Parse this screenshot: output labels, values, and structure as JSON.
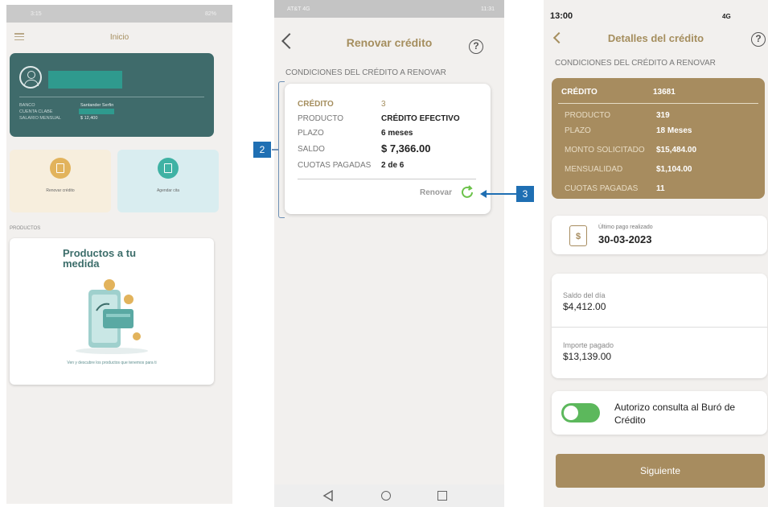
{
  "colors": {
    "gold": "#a58e5e",
    "teal": "#3f6b6b",
    "annotation_blue": "#1f6fb3",
    "toggle_green": "#5cb85c"
  },
  "screen1": {
    "status_time": "3:15",
    "status_right": "82%",
    "title": "Inicio",
    "account": {
      "rows": [
        {
          "label": "BANCO",
          "value": "Santander Serfin"
        },
        {
          "label": "CUENTA CLABE",
          "value": ""
        },
        {
          "label": "SALARIO MENSUAL",
          "value": "$ 12,400"
        }
      ]
    },
    "tiles": [
      {
        "label": "Renovar crédito",
        "icon": "document-icon"
      },
      {
        "label": "Agendar cita",
        "icon": "calendar-icon"
      }
    ],
    "section_label": "PRODUCTOS",
    "promo": {
      "title": "Productos a tu medida",
      "subtitle": "Ven y descubre los productos que tenemos para ti"
    }
  },
  "screen2": {
    "status_left": "AT&T 4G",
    "status_time": "11:31",
    "title": "Renovar crédito",
    "help": "?",
    "section_label": "CONDICIONES DEL CRÉDITO A RENOVAR",
    "card": {
      "credito_label": "CRÉDITO",
      "credito_value": "3",
      "producto_label": "PRODUCTO",
      "producto_value": "CRÉDITO EFECTIVO",
      "plazo_label": "PLAZO",
      "plazo_value": "6 meses",
      "saldo_label": "SALDO",
      "saldo_value": "$ 7,366.00",
      "cuotas_label": "CUOTAS PAGADAS",
      "cuotas_value": "2 de 6",
      "renovar_label": "Renovar"
    }
  },
  "annotations": {
    "two": "2",
    "three": "3"
  },
  "screen3": {
    "status_time": "13:00",
    "status_network": "4G",
    "title": "Detalles del crédito",
    "help": "?",
    "section_label": "CONDICIONES DEL CRÉDITO A RENOVAR",
    "card": {
      "credito_label": "CRÉDITO",
      "credito_value": "13681",
      "producto_label": "PRODUCTO",
      "producto_value": "319",
      "plazo_label": "PLAZO",
      "plazo_value": "18 Meses",
      "monto_label": "MONTO SOLICITADO",
      "monto_value": "$15,484.00",
      "mensualidad_label": "MENSUALIDAD",
      "mensualidad_value": "$1,104.00",
      "cuotas_label": "CUOTAS PAGADAS",
      "cuotas_value": "11"
    },
    "last_payment": {
      "label": "Último pago realizado",
      "date": "30-03-2023",
      "icon_glyph": "$"
    },
    "saldo": {
      "label": "Saldo del día",
      "value": "$4,412.00"
    },
    "importe": {
      "label": "Importe pagado",
      "value": "$13,139.00"
    },
    "authorization": {
      "text": "Autorizo consulta al Buró de Crédito",
      "enabled": true
    },
    "next_button": "Siguiente"
  }
}
